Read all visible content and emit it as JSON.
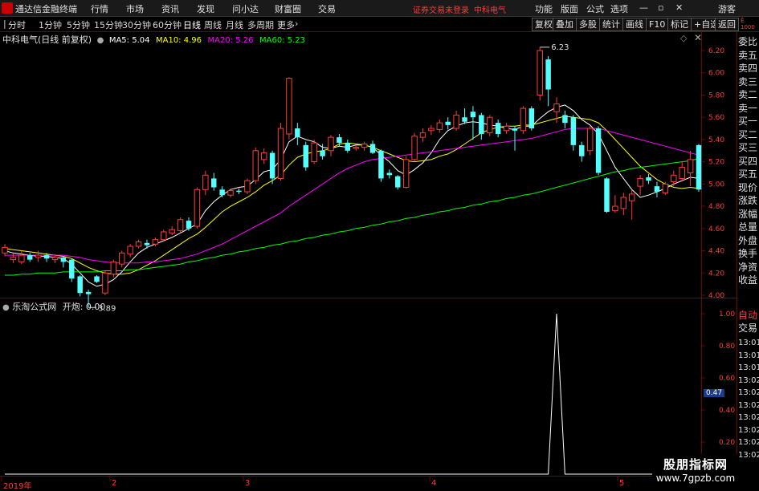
{
  "menubar": {
    "app_title": "通达信金融终端",
    "items": [
      "行情",
      "市场",
      "资讯",
      "发现",
      "问小达",
      "财富圈",
      "交易"
    ],
    "status_text": "证券交易未登录",
    "stock_name": "中科电气",
    "right_items": [
      "功能",
      "版面",
      "公式",
      "选项"
    ],
    "guest": "游客"
  },
  "periodbar": {
    "periods": [
      "分时",
      "1分钟",
      "5分钟",
      "15分钟",
      "30分钟",
      "60分钟",
      "日线",
      "周线",
      "月线",
      "多周期",
      "更多"
    ],
    "active": "日线",
    "right_buttons": [
      "复权",
      "叠加",
      "多股",
      "统计",
      "画线",
      "F10",
      "标记",
      "+自选",
      "返回"
    ]
  },
  "main_chart": {
    "title": "中科电气(日线 前复权)",
    "ma": [
      {
        "label": "MA5: 5.04",
        "color": "#ffffff"
      },
      {
        "label": "MA10: 4.96",
        "color": "#ffff00"
      },
      {
        "label": "MA20: 5.26",
        "color": "#ff00ff"
      },
      {
        "label": "MA60: 5.23",
        "color": "#00ff00"
      }
    ],
    "high_label": "6.23",
    "low_label": "3.89"
  },
  "sub_chart": {
    "title": "乐淘公式网",
    "indicator": "开炮: 0.00",
    "current_value": "0.47"
  },
  "side_panel": {
    "order_labels": [
      "委比",
      "卖五",
      "卖四",
      "卖三",
      "卖二",
      "卖一",
      "买一",
      "买二",
      "买三",
      "买四",
      "买五",
      "现价",
      "涨跌",
      "涨幅",
      "总量",
      "外盘",
      "换手",
      "净资",
      "收益"
    ],
    "auto_label": "自动",
    "trade_label": "交易",
    "times": [
      "13:01",
      "13:01",
      "13:01",
      "13:02",
      "13:02",
      "13:02",
      "13:02",
      "13:02",
      "13:02",
      "13:02"
    ]
  },
  "dates": [
    "2019年",
    "2",
    "3",
    "4",
    "5"
  ],
  "watermark": {
    "line1": "股朋指标网",
    "line2": "www.7gpzb.com"
  },
  "chart_data": [
    {
      "type": "candlestick",
      "title": "中科电气(日线 前复权)",
      "ylim": [
        3.8,
        6.35
      ],
      "yticks": [
        4.0,
        4.2,
        4.4,
        4.6,
        4.8,
        5.0,
        5.2,
        5.4,
        5.6,
        5.8,
        6.0,
        6.2
      ],
      "candles": [
        {
          "o": 4.38,
          "c": 4.43,
          "h": 4.46,
          "l": 4.35
        },
        {
          "o": 4.32,
          "c": 4.34,
          "h": 4.38,
          "l": 4.29
        },
        {
          "o": 4.3,
          "c": 4.36,
          "h": 4.4,
          "l": 4.28
        },
        {
          "o": 4.36,
          "c": 4.32,
          "h": 4.38,
          "l": 4.3
        },
        {
          "o": 4.34,
          "c": 4.36,
          "h": 4.4,
          "l": 4.3
        },
        {
          "o": 4.36,
          "c": 4.33,
          "h": 4.38,
          "l": 4.3
        },
        {
          "o": 4.32,
          "c": 4.34,
          "h": 4.37,
          "l": 4.29
        },
        {
          "o": 4.34,
          "c": 4.3,
          "h": 4.35,
          "l": 4.25
        },
        {
          "o": 4.32,
          "c": 4.15,
          "h": 4.33,
          "l": 4.12
        },
        {
          "o": 4.17,
          "c": 4.02,
          "h": 4.18,
          "l": 3.99
        },
        {
          "o": 4.03,
          "c": 4.01,
          "h": 4.05,
          "l": 3.89
        },
        {
          "o": 4.17,
          "c": 4.12,
          "h": 4.18,
          "l": 4.11
        },
        {
          "o": 4.02,
          "c": 4.2,
          "h": 4.22,
          "l": 4.0
        },
        {
          "o": 4.19,
          "c": 4.3,
          "h": 4.32,
          "l": 4.16
        },
        {
          "o": 4.28,
          "c": 4.38,
          "h": 4.4,
          "l": 4.25
        },
        {
          "o": 4.37,
          "c": 4.44,
          "h": 4.46,
          "l": 4.34
        },
        {
          "o": 4.44,
          "c": 4.48,
          "h": 4.5,
          "l": 4.42
        },
        {
          "o": 4.47,
          "c": 4.45,
          "h": 4.5,
          "l": 4.42
        },
        {
          "o": 4.46,
          "c": 4.5,
          "h": 4.52,
          "l": 4.44
        },
        {
          "o": 4.5,
          "c": 4.57,
          "h": 4.59,
          "l": 4.48
        },
        {
          "o": 4.56,
          "c": 4.59,
          "h": 4.62,
          "l": 4.54
        },
        {
          "o": 4.58,
          "c": 4.68,
          "h": 4.7,
          "l": 4.56
        },
        {
          "o": 4.67,
          "c": 4.6,
          "h": 4.7,
          "l": 4.58
        },
        {
          "o": 4.62,
          "c": 4.95,
          "h": 4.97,
          "l": 4.6
        },
        {
          "o": 4.95,
          "c": 5.08,
          "h": 5.12,
          "l": 4.9
        },
        {
          "o": 5.05,
          "c": 4.97,
          "h": 5.1,
          "l": 4.94
        },
        {
          "o": 4.95,
          "c": 4.9,
          "h": 4.98,
          "l": 4.88
        },
        {
          "o": 4.9,
          "c": 4.94,
          "h": 4.96,
          "l": 4.88
        },
        {
          "o": 4.94,
          "c": 4.93,
          "h": 4.96,
          "l": 4.91
        },
        {
          "o": 4.93,
          "c": 5.03,
          "h": 5.05,
          "l": 4.91
        },
        {
          "o": 5.03,
          "c": 5.3,
          "h": 5.33,
          "l": 5.0
        },
        {
          "o": 5.22,
          "c": 5.28,
          "h": 5.32,
          "l": 5.18
        },
        {
          "o": 5.28,
          "c": 5.05,
          "h": 5.3,
          "l": 5.0
        },
        {
          "o": 5.05,
          "c": 5.5,
          "h": 5.55,
          "l": 5.03
        },
        {
          "o": 5.45,
          "c": 5.95,
          "h": 5.96,
          "l": 5.4
        },
        {
          "o": 5.5,
          "c": 5.42,
          "h": 5.55,
          "l": 5.35
        },
        {
          "o": 5.35,
          "c": 5.15,
          "h": 5.38,
          "l": 5.12
        },
        {
          "o": 5.2,
          "c": 5.37,
          "h": 5.4,
          "l": 5.18
        },
        {
          "o": 5.3,
          "c": 5.25,
          "h": 5.36,
          "l": 5.22
        },
        {
          "o": 5.3,
          "c": 5.42,
          "h": 5.44,
          "l": 5.25
        },
        {
          "o": 5.42,
          "c": 5.37,
          "h": 5.45,
          "l": 5.34
        },
        {
          "o": 5.37,
          "c": 5.3,
          "h": 5.4,
          "l": 5.28
        },
        {
          "o": 5.32,
          "c": 5.33,
          "h": 5.35,
          "l": 5.3
        },
        {
          "o": 5.33,
          "c": 5.36,
          "h": 5.38,
          "l": 5.3
        },
        {
          "o": 5.36,
          "c": 5.28,
          "h": 5.39,
          "l": 5.27
        },
        {
          "o": 5.3,
          "c": 5.05,
          "h": 5.31,
          "l": 5.02
        },
        {
          "o": 5.1,
          "c": 5.08,
          "h": 5.13,
          "l": 5.05
        },
        {
          "o": 5.07,
          "c": 4.97,
          "h": 5.08,
          "l": 4.95
        },
        {
          "o": 4.97,
          "c": 5.22,
          "h": 5.25,
          "l": 4.96
        },
        {
          "o": 5.22,
          "c": 5.43,
          "h": 5.46,
          "l": 5.2
        },
        {
          "o": 5.42,
          "c": 5.46,
          "h": 5.5,
          "l": 5.38
        },
        {
          "o": 5.48,
          "c": 5.5,
          "h": 5.53,
          "l": 5.44
        },
        {
          "o": 5.49,
          "c": 5.55,
          "h": 5.58,
          "l": 5.46
        },
        {
          "o": 5.56,
          "c": 5.53,
          "h": 5.6,
          "l": 5.49
        },
        {
          "o": 5.5,
          "c": 5.62,
          "h": 5.66,
          "l": 5.48
        },
        {
          "o": 5.6,
          "c": 5.56,
          "h": 5.68,
          "l": 5.54
        },
        {
          "o": 5.65,
          "c": 5.6,
          "h": 5.7,
          "l": 5.4
        },
        {
          "o": 5.62,
          "c": 5.45,
          "h": 5.64,
          "l": 5.4
        },
        {
          "o": 5.46,
          "c": 5.6,
          "h": 5.62,
          "l": 5.43
        },
        {
          "o": 5.55,
          "c": 5.45,
          "h": 5.58,
          "l": 5.42
        },
        {
          "o": 5.48,
          "c": 5.52,
          "h": 5.55,
          "l": 5.45
        },
        {
          "o": 5.5,
          "c": 5.48,
          "h": 5.52,
          "l": 5.3
        },
        {
          "o": 5.48,
          "c": 5.68,
          "h": 5.7,
          "l": 5.45
        },
        {
          "o": 5.68,
          "c": 5.5,
          "h": 5.7,
          "l": 5.48
        },
        {
          "o": 5.8,
          "c": 6.2,
          "h": 6.23,
          "l": 5.75
        },
        {
          "o": 6.12,
          "c": 5.85,
          "h": 6.15,
          "l": 5.7
        },
        {
          "o": 5.65,
          "c": 5.72,
          "h": 5.78,
          "l": 5.55
        },
        {
          "o": 5.62,
          "c": 5.55,
          "h": 5.66,
          "l": 5.5
        },
        {
          "o": 5.6,
          "c": 5.35,
          "h": 5.62,
          "l": 5.3
        },
        {
          "o": 5.35,
          "c": 5.25,
          "h": 5.38,
          "l": 5.2
        },
        {
          "o": 5.3,
          "c": 5.5,
          "h": 5.52,
          "l": 5.26
        },
        {
          "o": 5.5,
          "c": 5.1,
          "h": 5.52,
          "l": 5.08
        },
        {
          "o": 5.05,
          "c": 4.75,
          "h": 5.06,
          "l": 4.74
        },
        {
          "o": 4.76,
          "c": 4.8,
          "h": 4.9,
          "l": 4.74
        },
        {
          "o": 4.78,
          "c": 4.88,
          "h": 4.92,
          "l": 4.72
        },
        {
          "o": 4.85,
          "c": 4.91,
          "h": 4.95,
          "l": 4.68
        },
        {
          "o": 4.98,
          "c": 5.05,
          "h": 5.08,
          "l": 4.9
        },
        {
          "o": 5.06,
          "c": 5.03,
          "h": 5.09,
          "l": 5.0
        },
        {
          "o": 4.98,
          "c": 4.93,
          "h": 5.02,
          "l": 4.88
        },
        {
          "o": 4.92,
          "c": 5.0,
          "h": 5.02,
          "l": 4.9
        },
        {
          "o": 5.02,
          "c": 5.08,
          "h": 5.12,
          "l": 4.98
        },
        {
          "o": 5.05,
          "c": 5.15,
          "h": 5.2,
          "l": 5.02
        },
        {
          "o": 5.1,
          "c": 5.22,
          "h": 5.3,
          "l": 4.98
        },
        {
          "o": 5.35,
          "c": 4.95,
          "h": 5.36,
          "l": 4.93
        }
      ],
      "series": [
        {
          "name": "MA5",
          "color": "#ffffff",
          "values": [
            4.4,
            4.38,
            4.37,
            4.36,
            4.35,
            4.35,
            4.34,
            4.33,
            4.28,
            4.2,
            4.12,
            4.08,
            4.1,
            4.14,
            4.21,
            4.3,
            4.38,
            4.43,
            4.46,
            4.49,
            4.52,
            4.56,
            4.6,
            4.64,
            4.76,
            4.84,
            4.9,
            4.95,
            4.97,
            4.98,
            5.04,
            5.11,
            5.13,
            5.22,
            5.38,
            5.43,
            5.4,
            5.38,
            5.33,
            5.32,
            5.34,
            5.33,
            5.35,
            5.35,
            5.33,
            5.26,
            5.2,
            5.12,
            5.08,
            5.13,
            5.19,
            5.28,
            5.4,
            5.48,
            5.52,
            5.55,
            5.56,
            5.55,
            5.53,
            5.52,
            5.5,
            5.49,
            5.52,
            5.52,
            5.59,
            5.65,
            5.69,
            5.71,
            5.66,
            5.58,
            5.53,
            5.45,
            5.3,
            5.15,
            5.05,
            4.95,
            4.88,
            4.9,
            4.93,
            4.96,
            5.0,
            5.03,
            5.06,
            5.05
          ]
        },
        {
          "name": "MA10",
          "color": "#ffff00",
          "values": [
            4.42,
            4.41,
            4.4,
            4.39,
            4.38,
            4.37,
            4.36,
            4.35,
            4.33,
            4.29,
            4.25,
            4.22,
            4.2,
            4.19,
            4.19,
            4.2,
            4.23,
            4.27,
            4.31,
            4.36,
            4.41,
            4.46,
            4.51,
            4.55,
            4.61,
            4.68,
            4.75,
            4.8,
            4.84,
            4.88,
            4.93,
            4.99,
            5.03,
            5.08,
            5.17,
            5.24,
            5.27,
            5.29,
            5.3,
            5.32,
            5.36,
            5.37,
            5.36,
            5.35,
            5.33,
            5.3,
            5.27,
            5.24,
            5.21,
            5.2,
            5.21,
            5.22,
            5.25,
            5.27,
            5.31,
            5.36,
            5.41,
            5.46,
            5.49,
            5.51,
            5.52,
            5.52,
            5.53,
            5.53,
            5.55,
            5.57,
            5.59,
            5.61,
            5.6,
            5.59,
            5.58,
            5.55,
            5.48,
            5.4,
            5.32,
            5.24,
            5.16,
            5.1,
            5.04,
            5.0,
            4.97,
            4.96,
            4.97,
            4.96
          ]
        },
        {
          "name": "MA20",
          "color": "#ff00ff",
          "values": [
            4.36,
            4.36,
            4.36,
            4.36,
            4.36,
            4.36,
            4.36,
            4.36,
            4.35,
            4.34,
            4.32,
            4.31,
            4.3,
            4.29,
            4.29,
            4.29,
            4.29,
            4.3,
            4.3,
            4.31,
            4.32,
            4.33,
            4.35,
            4.37,
            4.4,
            4.43,
            4.46,
            4.5,
            4.54,
            4.58,
            4.62,
            4.66,
            4.7,
            4.74,
            4.8,
            4.85,
            4.9,
            4.95,
            5.0,
            5.05,
            5.1,
            5.14,
            5.17,
            5.2,
            5.22,
            5.23,
            5.24,
            5.25,
            5.26,
            5.27,
            5.28,
            5.29,
            5.3,
            5.31,
            5.32,
            5.33,
            5.34,
            5.35,
            5.36,
            5.37,
            5.38,
            5.39,
            5.4,
            5.41,
            5.43,
            5.45,
            5.47,
            5.49,
            5.5,
            5.5,
            5.5,
            5.5,
            5.48,
            5.46,
            5.44,
            5.42,
            5.4,
            5.38,
            5.36,
            5.34,
            5.32,
            5.3,
            5.28,
            5.26
          ]
        },
        {
          "name": "MA60",
          "color": "#00ff00",
          "values": [
            4.18,
            4.18,
            4.19,
            4.19,
            4.2,
            4.2,
            4.2,
            4.21,
            4.21,
            4.21,
            4.21,
            4.21,
            4.22,
            4.22,
            4.22,
            4.23,
            4.23,
            4.24,
            4.25,
            4.26,
            4.27,
            4.28,
            4.3,
            4.31,
            4.33,
            4.34,
            4.36,
            4.37,
            4.39,
            4.4,
            4.42,
            4.43,
            4.45,
            4.46,
            4.48,
            4.49,
            4.51,
            4.52,
            4.54,
            4.55,
            4.57,
            4.58,
            4.6,
            4.61,
            4.63,
            4.64,
            4.66,
            4.67,
            4.69,
            4.7,
            4.72,
            4.73,
            4.75,
            4.76,
            4.78,
            4.79,
            4.81,
            4.82,
            4.84,
            4.85,
            4.87,
            4.88,
            4.9,
            4.91,
            4.93,
            4.95,
            4.97,
            4.99,
            5.01,
            5.03,
            5.05,
            5.07,
            5.09,
            5.11,
            5.12,
            5.14,
            5.15,
            5.16,
            5.17,
            5.18,
            5.19,
            5.2,
            5.21,
            5.23
          ]
        }
      ]
    },
    {
      "type": "line",
      "title": "乐淘公式网",
      "ylim": [
        0,
        1.05
      ],
      "yticks": [
        0.2,
        0.4,
        0.6,
        0.8,
        1.0
      ],
      "series": [
        {
          "name": "开炮",
          "color": "#ffffff",
          "values": [
            0,
            0,
            0,
            0,
            0,
            0,
            0,
            0,
            0,
            0,
            0,
            0,
            0,
            0,
            0,
            0,
            0,
            0,
            0,
            0,
            0,
            0,
            0,
            0,
            0,
            0,
            0,
            0,
            0,
            0,
            0,
            0,
            0,
            0,
            0,
            0,
            0,
            0,
            0,
            0,
            0,
            0,
            0,
            0,
            0,
            0,
            0,
            0,
            0,
            0,
            0,
            0,
            0,
            0,
            0,
            0,
            0,
            0,
            0,
            0,
            0,
            0,
            0,
            0,
            0,
            0,
            1,
            0,
            0,
            0,
            0,
            0,
            0,
            0,
            0,
            0,
            0,
            0,
            0,
            0,
            0,
            0,
            0,
            0
          ]
        }
      ]
    }
  ]
}
